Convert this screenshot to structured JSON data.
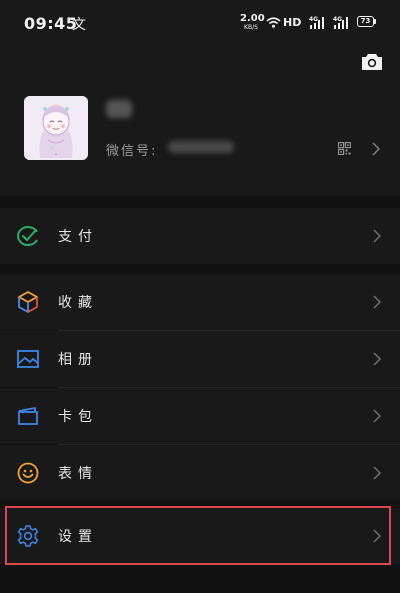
{
  "status_bar": {
    "time": "09:45",
    "notification_char": "文",
    "net_speed_value": "2.00",
    "net_speed_unit": "KB/S",
    "hd_label": "HD",
    "signal_1_label": "4G",
    "signal_2_label": "4G",
    "battery_level": "73",
    "icons": [
      "wifi-icon",
      "signal-icon",
      "battery-icon"
    ]
  },
  "profile": {
    "name": "***",
    "wechat_id_label": "微信号:",
    "wechat_id_value": "********",
    "icons": [
      "camera-icon",
      "qr-code-icon",
      "chevron-right-icon"
    ]
  },
  "menu": {
    "pay": {
      "label": "支付",
      "icon": "wallet-check-icon",
      "color": "#2aae67"
    },
    "favorites": {
      "label": "收藏",
      "icon": "cube-icon",
      "colors": [
        "#f0a13c",
        "#4c8de6",
        "#e3513c"
      ]
    },
    "album": {
      "label": "相册",
      "icon": "image-icon",
      "color": "#3d85e6"
    },
    "cards": {
      "label": "卡包",
      "icon": "card-icon",
      "color": "#3d85e6"
    },
    "stickers": {
      "label": "表情",
      "icon": "smiley-icon",
      "color": "#f0a13c"
    },
    "settings": {
      "label": "设置",
      "icon": "gear-icon",
      "color": "#3d85e6"
    }
  },
  "highlight": {
    "target": "settings",
    "color": "#d9484f"
  }
}
